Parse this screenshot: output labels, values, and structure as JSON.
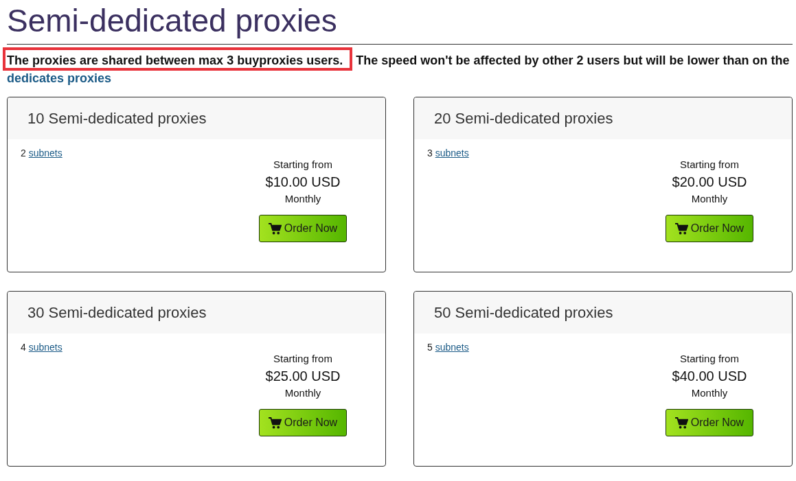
{
  "page_title": "Semi-dedicated proxies",
  "intro": {
    "highlighted": "The proxies are shared between max 3 buyproxies users.",
    "text": "The speed won't be affected by other 2 users but will be lower than on the",
    "link": "dedicates proxies"
  },
  "plans": [
    {
      "title": "10 Semi-dedicated proxies",
      "subnet_count": "2",
      "subnet_link": "subnets",
      "price_label": "Starting from",
      "price": "$10.00 USD",
      "period": "Monthly",
      "button": "Order Now"
    },
    {
      "title": "20 Semi-dedicated proxies",
      "subnet_count": "3",
      "subnet_link": "subnets",
      "price_label": "Starting from",
      "price": "$20.00 USD",
      "period": "Monthly",
      "button": "Order Now"
    },
    {
      "title": "30 Semi-dedicated proxies",
      "subnet_count": "4",
      "subnet_link": "subnets",
      "price_label": "Starting from",
      "price": "$25.00 USD",
      "period": "Monthly",
      "button": "Order Now"
    },
    {
      "title": "50 Semi-dedicated proxies",
      "subnet_count": "5",
      "subnet_link": "subnets",
      "price_label": "Starting from",
      "price": "$40.00 USD",
      "period": "Monthly",
      "button": "Order Now"
    }
  ]
}
